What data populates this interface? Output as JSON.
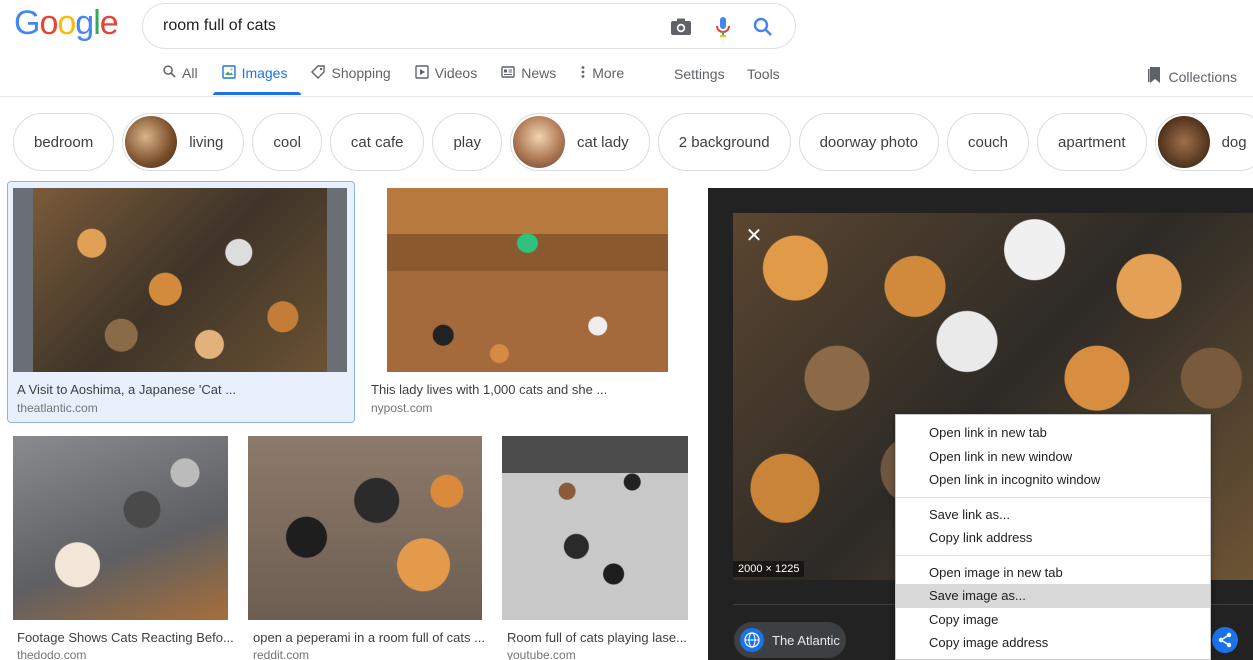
{
  "logo": {
    "letters": [
      "G",
      "o",
      "o",
      "g",
      "l",
      "e"
    ],
    "colors": [
      "#4285f4",
      "#ea4335",
      "#fbbc05",
      "#4285f4",
      "#34a853",
      "#ea4335"
    ]
  },
  "search": {
    "query": "room full of cats"
  },
  "tabs": [
    {
      "label": "All",
      "icon": "search-icon"
    },
    {
      "label": "Images",
      "icon": "image-icon",
      "active": true
    },
    {
      "label": "Shopping",
      "icon": "tag-icon"
    },
    {
      "label": "Videos",
      "icon": "play-icon"
    },
    {
      "label": "News",
      "icon": "news-icon"
    },
    {
      "label": "More",
      "icon": "more-vert-icon"
    }
  ],
  "tools": {
    "settings": "Settings",
    "tools": "Tools",
    "collections": "Collections"
  },
  "chips": [
    {
      "label": "bedroom",
      "thumb": false
    },
    {
      "label": "living",
      "thumb": true
    },
    {
      "label": "cool",
      "thumb": false
    },
    {
      "label": "cat cafe",
      "thumb": false
    },
    {
      "label": "play",
      "thumb": false
    },
    {
      "label": "cat lady",
      "thumb": true
    },
    {
      "label": "2 background",
      "thumb": false
    },
    {
      "label": "doorway photo",
      "thumb": false
    },
    {
      "label": "couch",
      "thumb": false
    },
    {
      "label": "apartment",
      "thumb": false
    },
    {
      "label": "dog",
      "thumb": true
    }
  ],
  "results": [
    {
      "caption": "A Visit to Aoshima, a Japanese 'Cat ...",
      "source": "theatlantic.com"
    },
    {
      "caption": "This lady lives with 1,000 cats and she ...",
      "source": "nypost.com"
    },
    {
      "caption": "Footage Shows Cats Reacting Befo...",
      "source": "thedodo.com"
    },
    {
      "caption": "open a peperami in a room full of cats ...",
      "source": "reddit.com"
    },
    {
      "caption": "Room full of cats playing lase...",
      "source": "youtube.com"
    }
  ],
  "preview": {
    "dimensions": "2000 × 1225",
    "source_name": "The Atlantic"
  },
  "context_menu": {
    "groups": [
      [
        "Open link in new tab",
        "Open link in new window",
        "Open link in incognito window"
      ],
      [
        "Save link as...",
        "Copy link address"
      ],
      [
        "Open image in new tab",
        "Save image as...",
        "Copy image",
        "Copy image address"
      ]
    ],
    "highlighted": "Save image as..."
  },
  "colors": {
    "accent": "#1a73e8",
    "panel_bg": "#222222",
    "menu_highlight": "#d9d9d9"
  }
}
